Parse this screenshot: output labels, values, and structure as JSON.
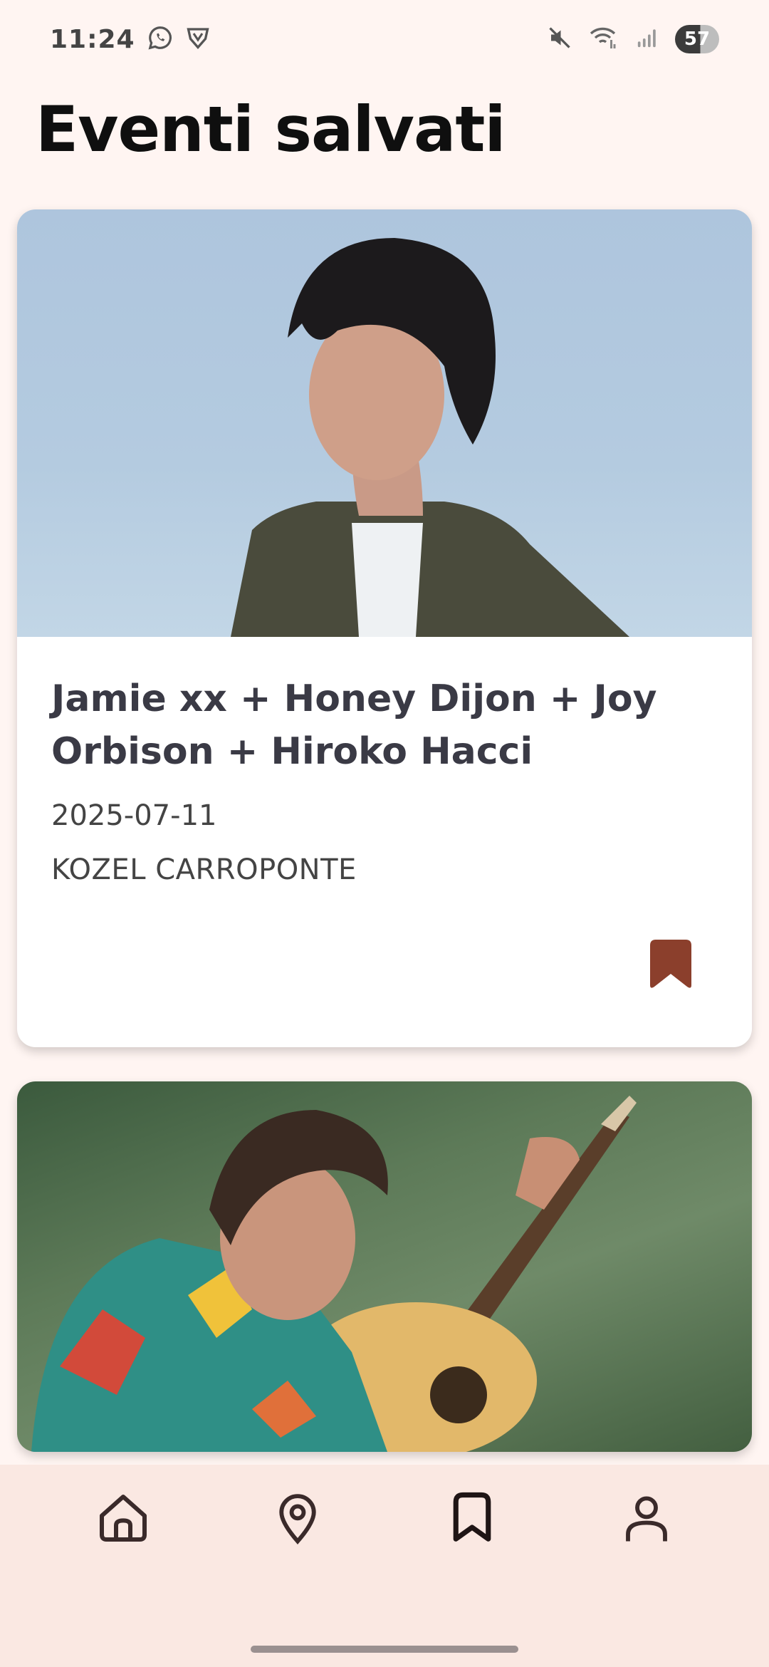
{
  "status_bar": {
    "time": "11:24",
    "icons": [
      "whatsapp-icon",
      "vpn-shield-icon",
      "mute-icon",
      "wifi-icon",
      "signal-icon"
    ],
    "battery": "57"
  },
  "page": {
    "title": "Eventi salvati"
  },
  "events": [
    {
      "title": "Jamie xx + Honey Dijon + Joy Orbison + Hiroko Hacci",
      "date": "2025-07-11",
      "venue": "KOZEL CARROPONTE",
      "saved": true,
      "bookmark_color": "#8b3f2c"
    },
    {
      "title": "",
      "date": "",
      "venue": "",
      "saved": true
    }
  ],
  "bottom_nav": {
    "items": [
      "home-icon",
      "map-pin-icon",
      "bookmark-icon",
      "profile-icon"
    ],
    "active": "bookmark-icon"
  },
  "colors": {
    "background": "#fff5f2",
    "nav_background": "#fae8e2",
    "accent": "#8b3f2c"
  }
}
